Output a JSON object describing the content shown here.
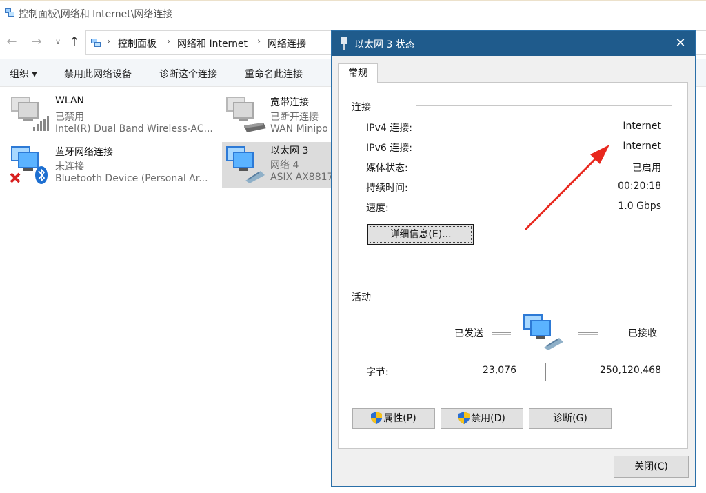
{
  "explorer": {
    "title": "控制面板\\网络和 Internet\\网络连接",
    "breadcrumb": [
      "控制面板",
      "网络和 Internet",
      "网络连接"
    ],
    "commands": [
      "组织 ▾",
      "禁用此网络设备",
      "诊断这个连接",
      "重命名此连接"
    ],
    "items": [
      {
        "name": "WLAN",
        "status": "已禁用",
        "device": "Intel(R) Dual Band Wireless-AC..."
      },
      {
        "name": "宽带连接",
        "status": "已断开连接",
        "device": "WAN Minipo"
      },
      {
        "name": "蓝牙网络连接",
        "status": "未连接",
        "device": "Bluetooth Device (Personal Ar..."
      },
      {
        "name": "以太网 3",
        "status": "网络 4",
        "device": "ASIX AX8817"
      }
    ]
  },
  "dialog": {
    "title": "以太网 3 状态",
    "close_glyph": "✕",
    "tab": "常规",
    "connection": {
      "label": "连接",
      "rows": [
        {
          "label": "IPv4 连接:",
          "value": "Internet"
        },
        {
          "label": "IPv6 连接:",
          "value": "Internet"
        },
        {
          "label": "媒体状态:",
          "value": "已启用"
        },
        {
          "label": "持续时间:",
          "value": "00:20:18"
        },
        {
          "label": "速度:",
          "value": "1.0 Gbps"
        }
      ],
      "details_button": "详细信息(E)..."
    },
    "activity": {
      "label": "活动",
      "sent_label": "已发送",
      "received_label": "已接收",
      "bytes_label": "字节:",
      "bytes_sent": "23,076",
      "bytes_received": "250,120,468"
    },
    "buttons": {
      "properties": "属性(P)",
      "disable": "禁用(D)",
      "diagnose": "诊断(G)",
      "close": "关闭(C)"
    }
  },
  "colors": {
    "dialog_title_bar": "#1f5b8c",
    "annotation_arrow": "#e8281e",
    "selected_item": "#dcdcdc"
  }
}
